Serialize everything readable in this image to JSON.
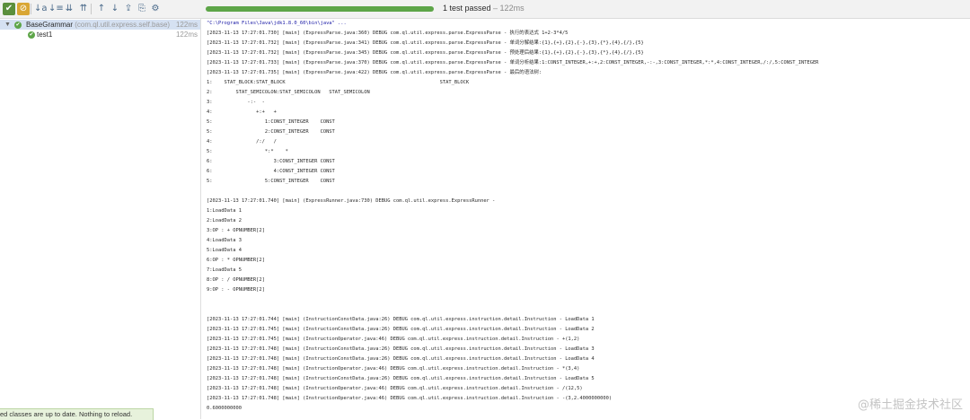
{
  "toolbar": {
    "buttons": [
      {
        "icon": "run-passed-icon",
        "glyph": "✔"
      },
      {
        "icon": "show-ignored-icon",
        "glyph": "⊘"
      },
      {
        "icon": "sort-alpha-icon",
        "glyph": "↓a"
      },
      {
        "icon": "sort-duration-icon",
        "glyph": "↓≡"
      },
      {
        "icon": "expand-all-icon",
        "glyph": "⇊"
      },
      {
        "icon": "collapse-all-icon",
        "glyph": "⇈"
      },
      {
        "icon": "prev-failed-icon",
        "glyph": "↑"
      },
      {
        "icon": "next-failed-icon",
        "glyph": "↓"
      },
      {
        "icon": "export-icon",
        "glyph": "⇪"
      },
      {
        "icon": "import-icon",
        "glyph": "⎘"
      },
      {
        "icon": "settings-icon",
        "glyph": "⚙"
      }
    ],
    "progress_fraction": 1.0,
    "progress_color": "#5da548",
    "status_text": "1 test passed",
    "status_duration": " – 122ms"
  },
  "tree": {
    "root": {
      "name": "BaseGrammar",
      "package": " (com.ql.util.express.self.base)",
      "time": "122ms"
    },
    "children": [
      {
        "name": "test1",
        "time": "122ms"
      }
    ]
  },
  "console": {
    "lines": [
      "\"C:\\Program Files\\Java\\jdk1.8.0_60\\bin\\java\" ...",
      "[2023-11-13 17:27:01.730] [main] (ExpressParse.java:360) DEBUG com.ql.util.express.parse.ExpressParse - 执行的表达式 1+2-3*4/5",
      "[2023-11-13 17:27:01.732] [main] (ExpressParse.java:341) DEBUG com.ql.util.express.parse.ExpressParse - 单词分解结果:{1},{+},{2},{-},{3},{*},{4},{/},{5}",
      "[2023-11-13 17:27:01.732] [main] (ExpressParse.java:345) DEBUG com.ql.util.express.parse.ExpressParse - 预处理后结果:{1},{+},{2},{-},{3},{*},{4},{/},{5}",
      "[2023-11-13 17:27:01.733] [main] (ExpressParse.java:370) DEBUG com.ql.util.express.parse.ExpressParse - 单词分析结果:1:CONST_INTEGER,+:+,2:CONST_INTEGER,-:-,3:CONST_INTEGER,*:*,4:CONST_INTEGER,/:/,5:CONST_INTEGER",
      "[2023-11-13 17:27:01.735] [main] (ExpressParse.java:422) DEBUG com.ql.util.express.parse.ExpressParse - 最后的语法树:",
      "1:    STAT_BLOCK:STAT_BLOCK                                                     STAT_BLOCK",
      "2:        STAT_SEMICOLON:STAT_SEMICOLON   STAT_SEMICOLON",
      "3:            -:-  -",
      "4:               +:+   +",
      "5:                  1:CONST_INTEGER    CONST",
      "5:                  2:CONST_INTEGER    CONST",
      "4:               /:/   /",
      "5:                  *:*    *",
      "6:                     3:CONST_INTEGER CONST",
      "6:                     4:CONST_INTEGER CONST",
      "5:                  5:CONST_INTEGER    CONST",
      "",
      "[2023-11-13 17:27:01.740] [main] (ExpressRunner.java:730) DEBUG com.ql.util.express.ExpressRunner -",
      "1:LoadData 1",
      "2:LoadData 2",
      "3:OP : + OPNUMBER[2]",
      "4:LoadData 3",
      "5:LoadData 4",
      "6:OP : * OPNUMBER[2]",
      "7:LoadData 5",
      "8:OP : / OPNUMBER[2]",
      "9:OP : - OPNUMBER[2]",
      "",
      "",
      "[2023-11-13 17:27:01.744] [main] (InstructionConstData.java:26) DEBUG com.ql.util.express.instruction.detail.Instruction - LoadData 1",
      "[2023-11-13 17:27:01.745] [main] (InstructionConstData.java:26) DEBUG com.ql.util.express.instruction.detail.Instruction - LoadData 2",
      "[2023-11-13 17:27:01.745] [main] (InstructionOperator.java:46) DEBUG com.ql.util.express.instruction.detail.Instruction - +(1,2)",
      "[2023-11-13 17:27:01.748] [main] (InstructionConstData.java:26) DEBUG com.ql.util.express.instruction.detail.Instruction - LoadData 3",
      "[2023-11-13 17:27:01.748] [main] (InstructionConstData.java:26) DEBUG com.ql.util.express.instruction.detail.Instruction - LoadData 4",
      "[2023-11-13 17:27:01.748] [main] (InstructionOperator.java:46) DEBUG com.ql.util.express.instruction.detail.Instruction - *(3,4)",
      "[2023-11-13 17:27:01.748] [main] (InstructionConstData.java:26) DEBUG com.ql.util.express.instruction.detail.Instruction - LoadData 5",
      "[2023-11-13 17:27:01.748] [main] (InstructionOperator.java:46) DEBUG com.ql.util.express.instruction.detail.Instruction - /(12,5)",
      "[2023-11-13 17:27:01.748] [main] (InstructionOperator.java:46) DEBUG com.ql.util.express.instruction.detail.Instruction - -(3,2.4000000000)",
      "0.6000000000"
    ]
  },
  "notification": {
    "text": "ed classes are up to date. Nothing to reload."
  },
  "watermark": {
    "text": "@稀土掘金技术社区"
  }
}
